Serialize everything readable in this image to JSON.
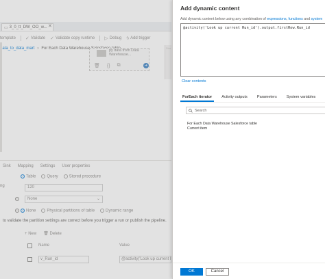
{
  "editor": {
    "tab_label": "3_0_tt_DW_OO_w...",
    "toolbar": [
      "template",
      "Validate",
      "Validate copy runtime",
      "Debug",
      "Add trigger"
    ],
    "breadcrumb_link": "data_to_data_mart",
    "breadcrumb_sep": "›",
    "breadcrumb_current": "For Each Data Warehouse Salesforce table",
    "activity_name": "py data from Data Warehouse...",
    "canvas_side_label": "Stor",
    "bottom_tabs": [
      "Sink",
      "Mapping",
      "Settings",
      "User properties"
    ],
    "use_query": {
      "label": "ng",
      "options": [
        "Table",
        "Query",
        "Stored procedure"
      ],
      "selected": "Table"
    },
    "table_field": "120",
    "partition_field": "None",
    "partition_options": [
      "None",
      "Physical partitions of table",
      "Dynamic range"
    ],
    "partition_note": "to validate the partition settings are correct before you trigger a run or publish the pipeline.",
    "params_new": "New",
    "params_delete": "Delete",
    "grid_headers": [
      "Name",
      "Value"
    ],
    "grid_row": {
      "name": "v_Run_id",
      "value": "@activity('Look up current Ru..."
    }
  },
  "panel": {
    "title": "Add dynamic content",
    "desc_prefix": "Add dynamic content below using any combination of ",
    "desc_link1": "expressions",
    "desc_comma": ", ",
    "desc_link2": "functions",
    "desc_and": " and ",
    "desc_link3": "system",
    "expression": "@activity('Look up current Run_id').output.firstRow.Run_id",
    "clear_link": "Clear contents",
    "tabs": [
      "ForEach iterator",
      "Activity outputs",
      "Parameters",
      "System variables"
    ],
    "active_tab": "ForEach iterator",
    "search_placeholder": "Search",
    "iterator_title": "For Each Data Warehouse Salesforce table",
    "iterator_sub": "Current item",
    "ok_label": "OK",
    "cancel_label": "Cancel",
    "accent": "#0078d4"
  }
}
